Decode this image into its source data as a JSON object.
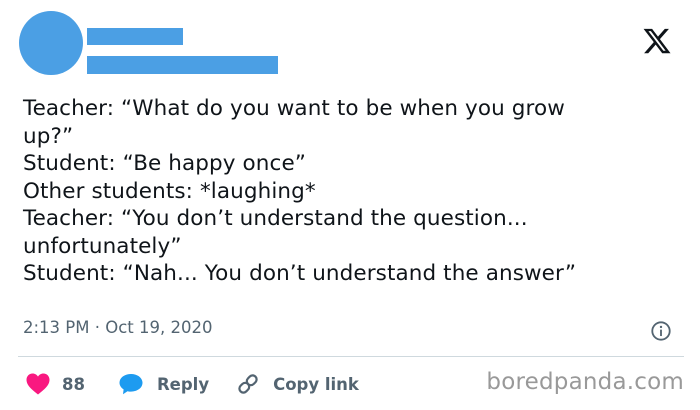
{
  "tweet": {
    "lines": [
      "Teacher: “What do you want to be when you grow",
      "up?”",
      "Student: “Be happy once”",
      "Other students: *laughing*",
      "Teacher: “You don’t understand the question...",
      "unfortunately”",
      "Student: “Nah... You don’t understand the answer”"
    ],
    "timestamp": "2:13 PM · Oct 19, 2020"
  },
  "actions": {
    "like_count": "88",
    "reply_label": "Reply",
    "copy_link_label": "Copy link"
  },
  "icons": {
    "like": "heart-icon",
    "reply": "speech-bubble-icon",
    "copy": "link-icon",
    "info": "info-icon",
    "brand": "x-logo-icon"
  },
  "colors": {
    "avatar_placeholder": "#4b9fe4",
    "like": "#f91880",
    "reply": "#1d9bf0",
    "muted": "#536471"
  },
  "watermark": "boredpanda.com"
}
